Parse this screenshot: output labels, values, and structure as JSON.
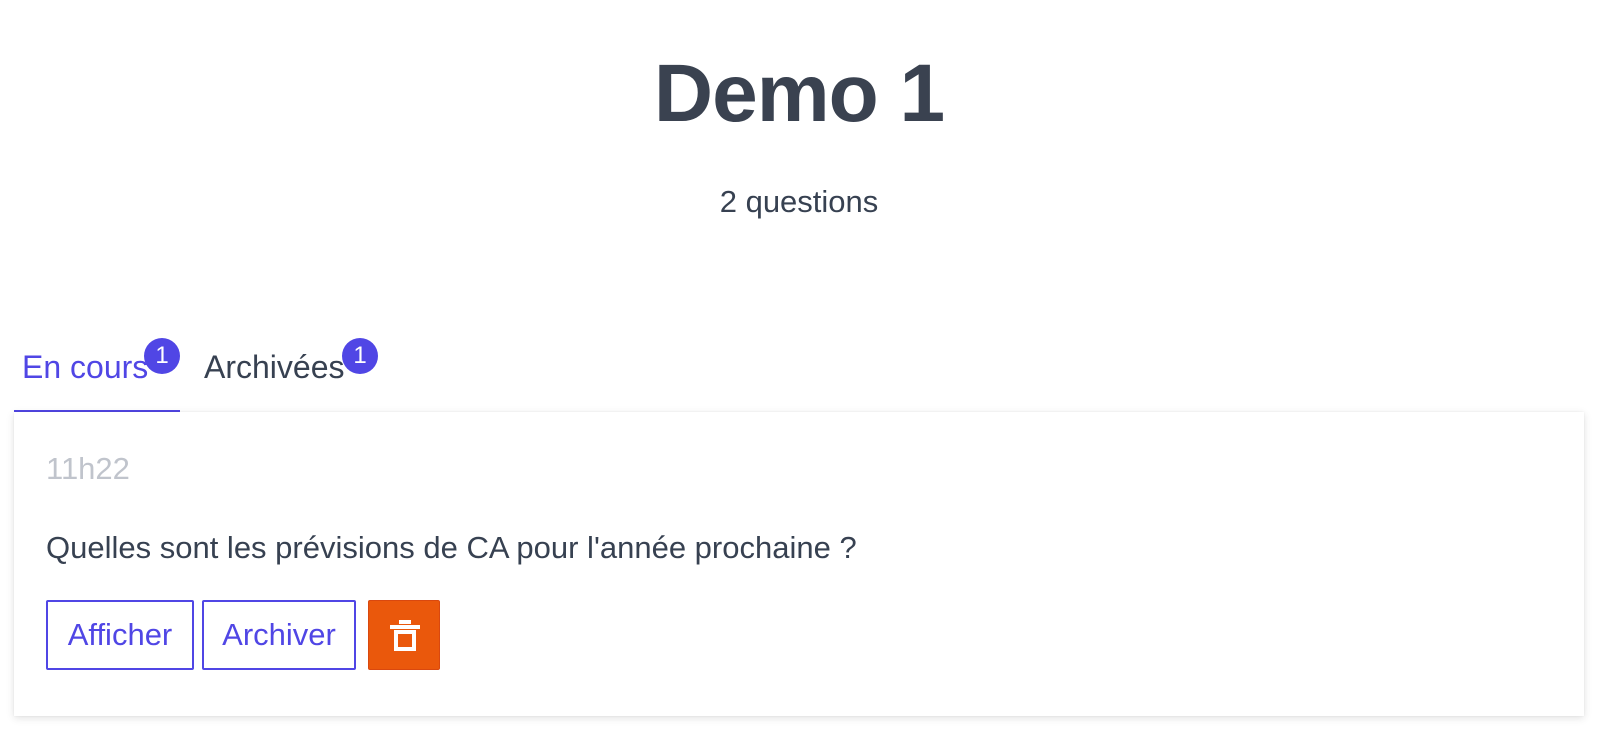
{
  "header": {
    "title": "Demo 1",
    "subtitle": "2 questions"
  },
  "tabs": [
    {
      "label": "En cours",
      "badge": "1",
      "active": true
    },
    {
      "label": "Archivées",
      "badge": "1",
      "active": false
    }
  ],
  "questions": [
    {
      "time": "11h22",
      "text": "Quelles sont les prévisions de CA pour l'année prochaine ?",
      "actions": {
        "show_label": "Afficher",
        "archive_label": "Archiver",
        "delete_icon": "trash-icon"
      }
    }
  ],
  "colors": {
    "accent": "#5046e5",
    "danger": "#ea580c",
    "text": "#374151",
    "muted": "#c0c4cc"
  }
}
